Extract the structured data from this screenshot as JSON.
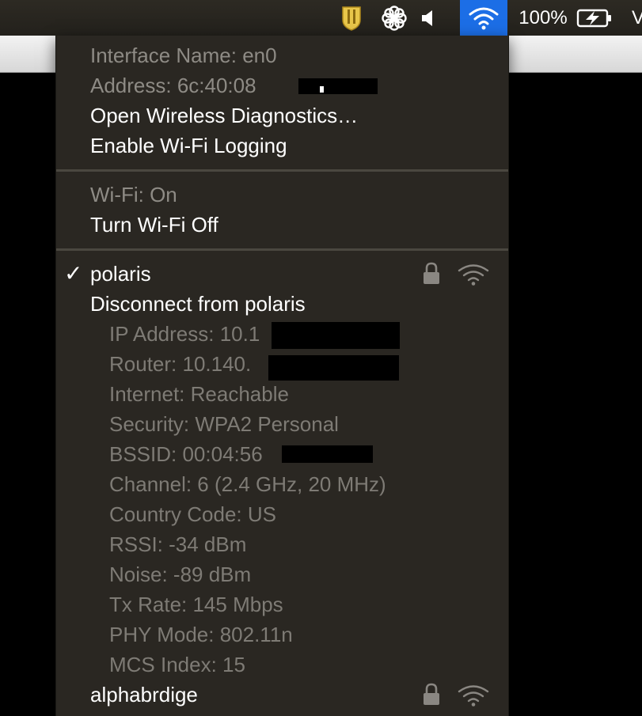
{
  "menubar": {
    "battery_percent": "100%",
    "user_initial": "V"
  },
  "wifi_menu": {
    "interface_info": {
      "interface_name": "Interface Name: en0",
      "address": "Address: 6c:40:08"
    },
    "actions": {
      "open_diagnostics": "Open Wireless Diagnostics…",
      "enable_logging": "Enable Wi-Fi Logging"
    },
    "wifi_status": "Wi-Fi: On",
    "turn_off": "Turn Wi-Fi Off",
    "connected_network": {
      "checkmark": "✓",
      "name": "polaris",
      "disconnect": "Disconnect from polaris",
      "details": {
        "ip_address": "IP Address: 10.1",
        "router": "Router: 10.140.",
        "internet": "Internet: Reachable",
        "security": "Security: WPA2 Personal",
        "bssid": "BSSID: 00:04:56",
        "channel": "Channel: 6 (2.4 GHz, 20 MHz)",
        "country_code": "Country Code: US",
        "rssi": "RSSI: -34 dBm",
        "noise": "Noise: -89 dBm",
        "tx_rate": "Tx Rate: 145 Mbps",
        "phy_mode": "PHY Mode: 802.11n",
        "mcs_index": "MCS Index: 15"
      }
    },
    "other_networks": [
      {
        "name": "alphabrdige"
      }
    ]
  },
  "colors": {
    "menu_bg": "#2a2722",
    "wifi_highlight": "#1c6ee6",
    "separator": "#4a4740",
    "shield_gold": "#e8c64a"
  }
}
